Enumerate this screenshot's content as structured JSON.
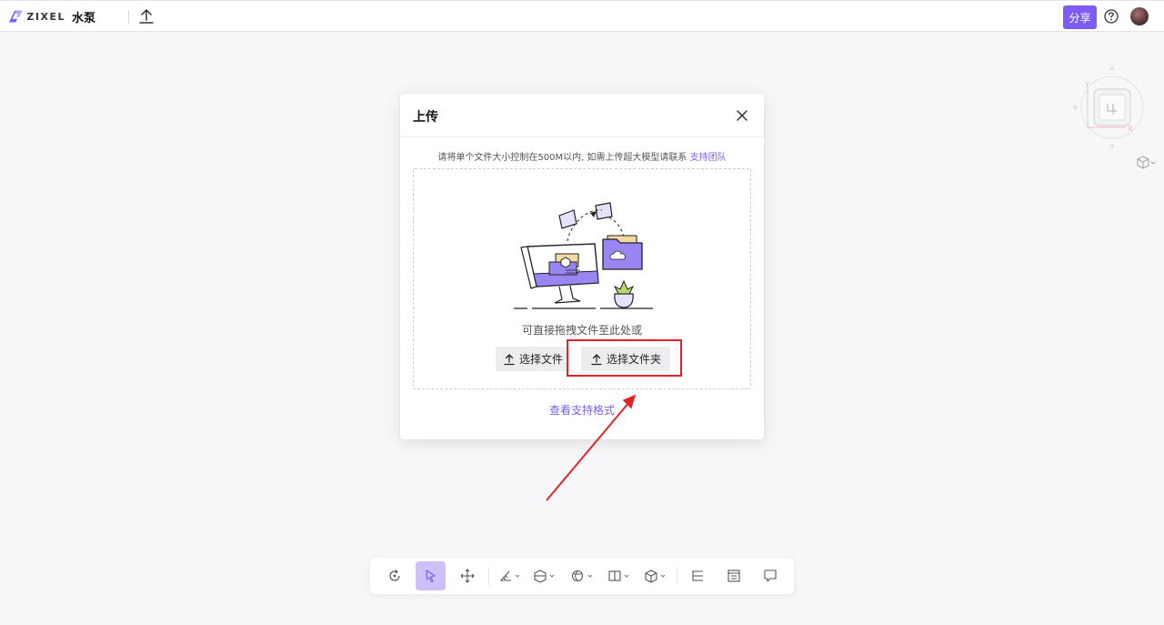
{
  "header": {
    "logo_text": "ZIXEL",
    "project_title": "水泵",
    "share_label": "分享"
  },
  "upload_modal": {
    "title": "上传",
    "notice_text": "请将单个文件大小控制在500M以内, 如需上传超大模型请联系 ",
    "notice_link": "支持团队",
    "drag_text": "可直接拖拽文件至此处或",
    "select_file_label": "选择文件",
    "select_folder_label": "选择文件夹",
    "formats_link": "查看支持格式"
  },
  "colors": {
    "accent": "#7c5cf4",
    "highlight": "#e0242a"
  },
  "icons": {
    "logo": "zixel-logo-icon",
    "upload": "upload-icon",
    "help": "help-icon",
    "close": "close-icon",
    "viewcube": "viewcube-icon",
    "view_mode": "cube-icon"
  },
  "toolbar": {
    "buttons": [
      "rotate-view",
      "select",
      "move",
      "measure",
      "section",
      "explode",
      "split-view",
      "model-view",
      "structure-tree",
      "properties",
      "comments"
    ],
    "active": "select"
  }
}
